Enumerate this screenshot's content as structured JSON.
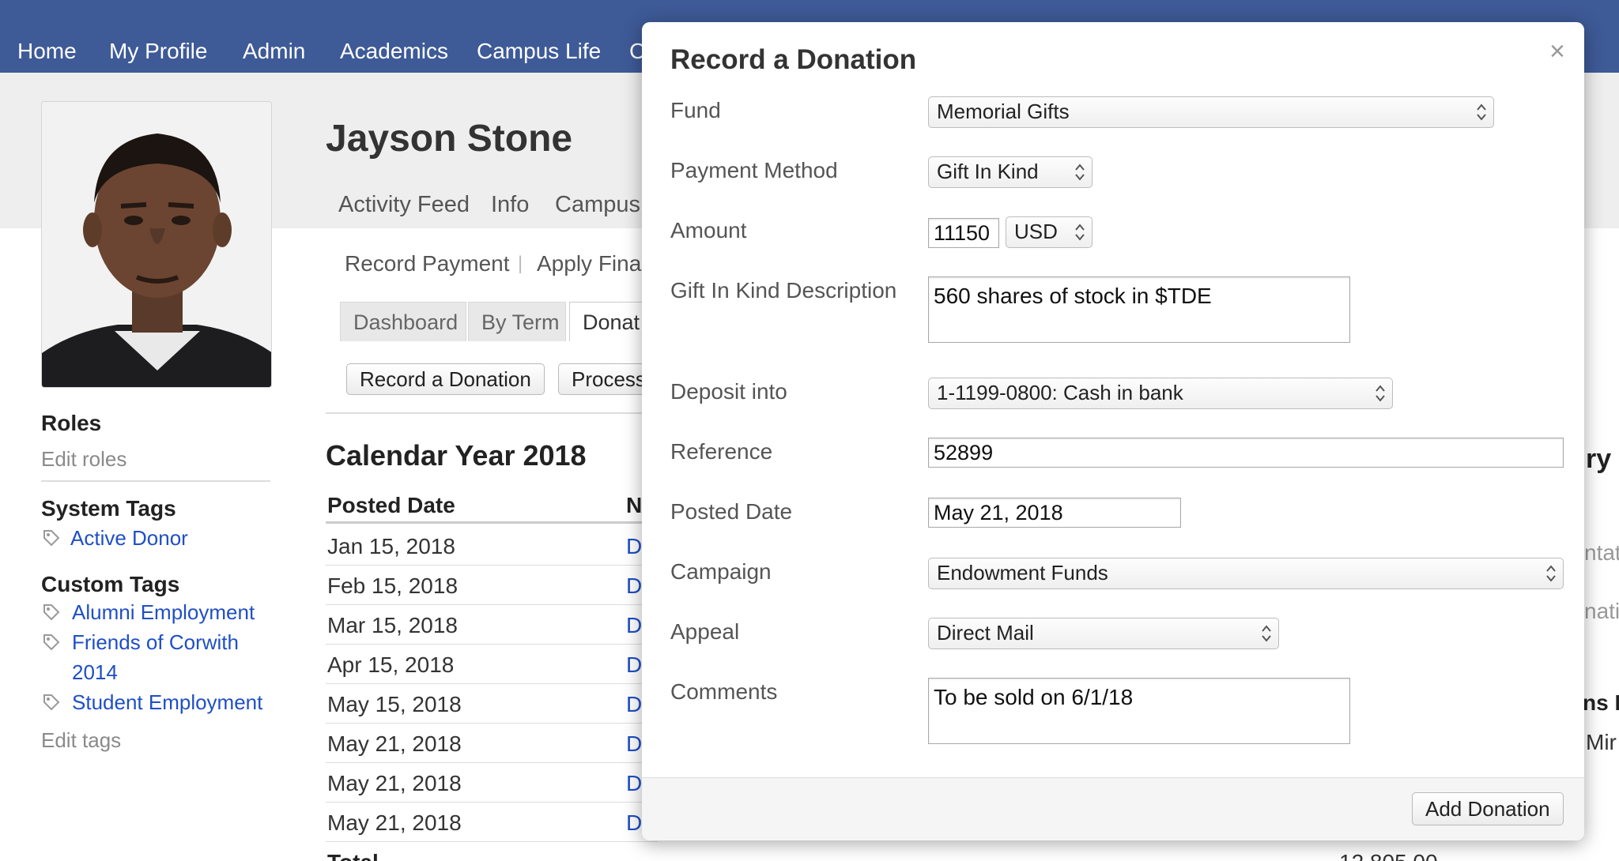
{
  "nav": {
    "items": [
      "Home",
      "My Profile",
      "Admin",
      "Academics",
      "Campus Life",
      "C"
    ]
  },
  "profile": {
    "name": "Jayson Stone",
    "subtabs": [
      "Activity Feed",
      "Info",
      "Campus L"
    ],
    "actions": [
      "Record Payment",
      "|",
      "Apply Finar"
    ],
    "section_tabs": [
      "Dashboard",
      "By Term",
      "Donat"
    ],
    "buttons": [
      "Record a Donation",
      "Process"
    ]
  },
  "sidebar": {
    "roles_heading": "Roles",
    "edit_roles": "Edit roles",
    "system_tags_heading": "System Tags",
    "system_tags": [
      "Active Donor"
    ],
    "custom_tags_heading": "Custom Tags",
    "custom_tags": [
      "Alumni Employment",
      "Friends of Corwith",
      "2014",
      "Student Employment"
    ],
    "edit_tags": "Edit tags"
  },
  "donations": {
    "heading": "Calendar Year 2018",
    "col_posted_date": "Posted Date",
    "col_next": "N",
    "rows": [
      {
        "date": "Jan 15, 2018",
        "link": "D"
      },
      {
        "date": "Feb 15, 2018",
        "link": "D"
      },
      {
        "date": "Mar 15, 2018",
        "link": "D"
      },
      {
        "date": "Apr 15, 2018",
        "link": "D"
      },
      {
        "date": "May 15, 2018",
        "link": "D"
      },
      {
        "date": "May 21, 2018",
        "link": "D"
      },
      {
        "date": "May 21, 2018",
        "link": "D"
      },
      {
        "date": "May 21, 2018",
        "link": "D"
      }
    ],
    "total_label": "Total",
    "total_value": "12,805.00"
  },
  "right_fragments": [
    "ry",
    "ntat",
    "nati",
    "ns E",
    "Mir"
  ],
  "modal": {
    "title": "Record a Donation",
    "close_glyph": "×",
    "labels": {
      "fund": "Fund",
      "payment_method": "Payment Method",
      "amount": "Amount",
      "gik_description": "Gift In Kind Description",
      "deposit_into": "Deposit into",
      "reference": "Reference",
      "posted_date": "Posted Date",
      "campaign": "Campaign",
      "appeal": "Appeal",
      "comments": "Comments"
    },
    "values": {
      "fund": "Memorial Gifts",
      "payment_method": "Gift In Kind",
      "amount": "11150",
      "currency": "USD",
      "gik_description": "560 shares of stock in $TDE",
      "deposit_into": "1-1199-0800: Cash in bank",
      "reference": "52899",
      "posted_date": "May 21, 2018",
      "campaign": "Endowment Funds",
      "appeal": "Direct Mail",
      "comments": "To be sold on 6/1/18"
    },
    "submit_label": "Add Donation"
  },
  "colors": {
    "nav_bg": "#3e5a97",
    "link": "#1f4fc4",
    "band_bg": "#eeeeee"
  }
}
